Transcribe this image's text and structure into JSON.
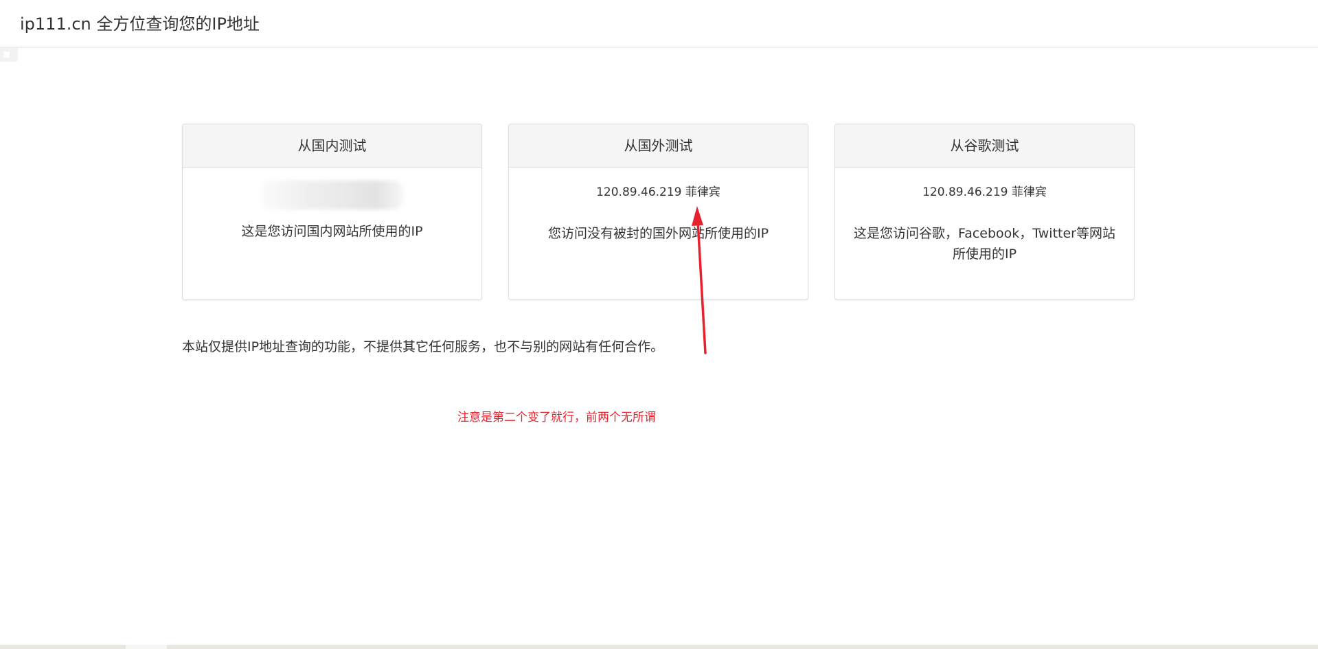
{
  "header": {
    "title": "ip111.cn 全方位查询您的IP地址"
  },
  "cards": [
    {
      "title": "从国内测试",
      "ip": "",
      "description": "这是您访问国内网站所使用的IP"
    },
    {
      "title": "从国外测试",
      "ip": "120.89.46.219 菲律宾",
      "description": "您访问没有被封的国外网站所使用的IP"
    },
    {
      "title": "从谷歌测试",
      "ip": "120.89.46.219 菲律宾",
      "description": "这是您访问谷歌，Facebook，Twitter等网站所使用的IP"
    }
  ],
  "footer": {
    "note": "本站仅提供IP地址查询的功能，不提供其它任何服务，也不与别的网站有任何合作。"
  },
  "annotation": {
    "note": "注意是第二个变了就行，前两个无所谓",
    "color": "#e8222d"
  },
  "icons": {
    "arrow": "red-arrow-icon",
    "corner": "sidebar-toggle-icon"
  }
}
